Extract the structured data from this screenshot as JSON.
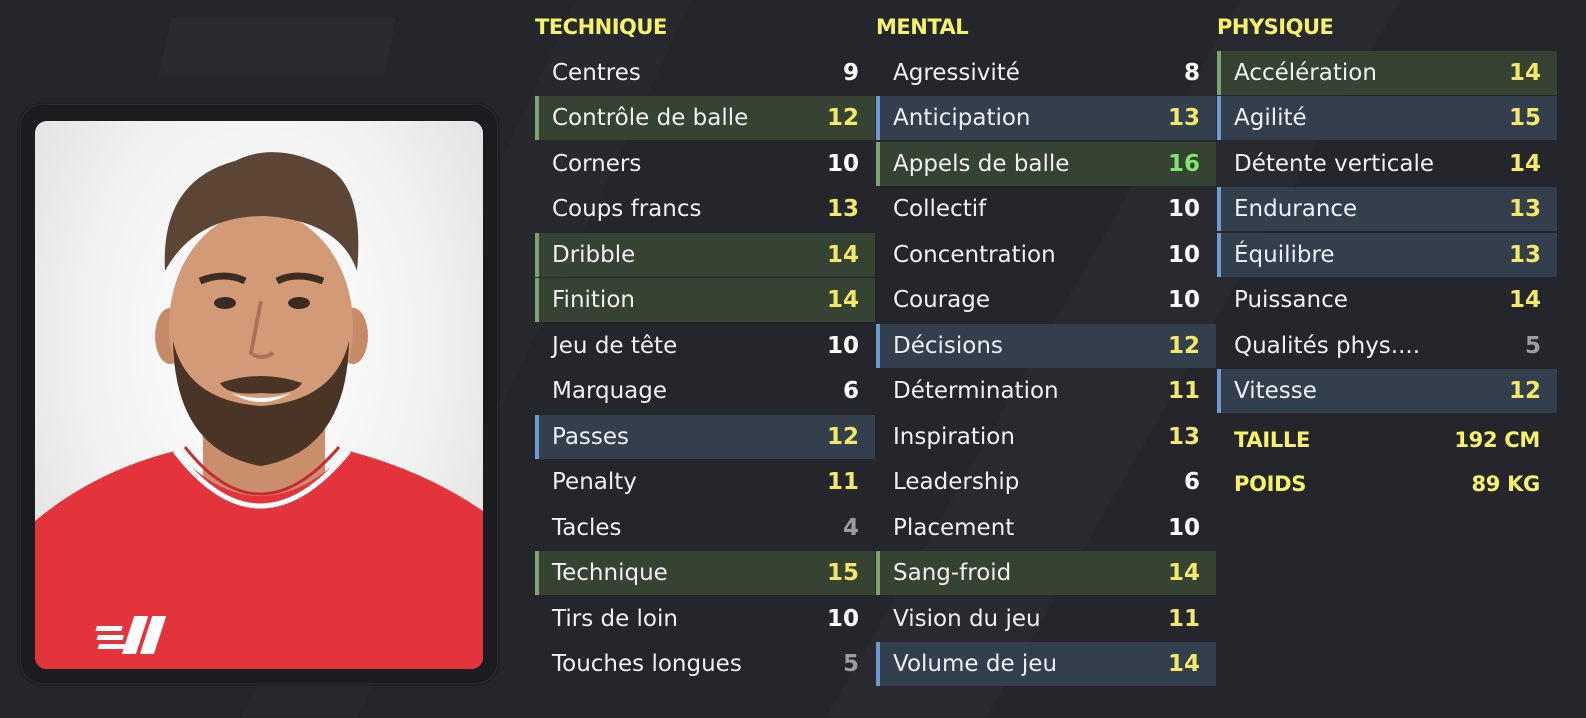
{
  "colors": {
    "background": "#24262c",
    "heading": "#f6f26a",
    "highlight_green": "#364232",
    "highlight_blue": "#333f4d",
    "value_white": "#ffffff",
    "value_yellow": "#f3e86a",
    "value_green": "#7de66b",
    "value_grey": "#9a9da2"
  },
  "technique": {
    "title": "TECHNIQUE",
    "items": [
      {
        "label": "Centres",
        "value": "9"
      },
      {
        "label": "Contrôle de balle",
        "value": "12"
      },
      {
        "label": "Corners",
        "value": "10"
      },
      {
        "label": "Coups francs",
        "value": "13"
      },
      {
        "label": "Dribble",
        "value": "14"
      },
      {
        "label": "Finition",
        "value": "14"
      },
      {
        "label": "Jeu de tête",
        "value": "10"
      },
      {
        "label": "Marquage",
        "value": "6"
      },
      {
        "label": "Passes",
        "value": "12"
      },
      {
        "label": "Penalty",
        "value": "11"
      },
      {
        "label": "Tacles",
        "value": "4"
      },
      {
        "label": "Technique",
        "value": "15"
      },
      {
        "label": "Tirs de loin",
        "value": "10"
      },
      {
        "label": "Touches longues",
        "value": "5"
      }
    ]
  },
  "mental": {
    "title": "MENTAL",
    "items": [
      {
        "label": "Agressivité",
        "value": "8"
      },
      {
        "label": "Anticipation",
        "value": "13"
      },
      {
        "label": "Appels de balle",
        "value": "16"
      },
      {
        "label": "Collectif",
        "value": "10"
      },
      {
        "label": "Concentration",
        "value": "10"
      },
      {
        "label": "Courage",
        "value": "10"
      },
      {
        "label": "Décisions",
        "value": "12"
      },
      {
        "label": "Détermination",
        "value": "11"
      },
      {
        "label": "Inspiration",
        "value": "13"
      },
      {
        "label": "Leadership",
        "value": "6"
      },
      {
        "label": "Placement",
        "value": "10"
      },
      {
        "label": "Sang-froid",
        "value": "14"
      },
      {
        "label": "Vision du jeu",
        "value": "11"
      },
      {
        "label": "Volume de jeu",
        "value": "14"
      }
    ]
  },
  "physique": {
    "title": "PHYSIQUE",
    "items": [
      {
        "label": "Accélération",
        "value": "14"
      },
      {
        "label": "Agilité",
        "value": "15"
      },
      {
        "label": "Détente verticale",
        "value": "14"
      },
      {
        "label": "Endurance",
        "value": "13"
      },
      {
        "label": "Équilibre",
        "value": "13"
      },
      {
        "label": "Puissance",
        "value": "14"
      },
      {
        "label": "Qualités phys....",
        "value": "5"
      },
      {
        "label": "Vitesse",
        "value": "12"
      }
    ],
    "taille_label": "TAILLE",
    "taille_value": "192 CM",
    "poids_label": "POIDS",
    "poids_value": "89 KG"
  }
}
